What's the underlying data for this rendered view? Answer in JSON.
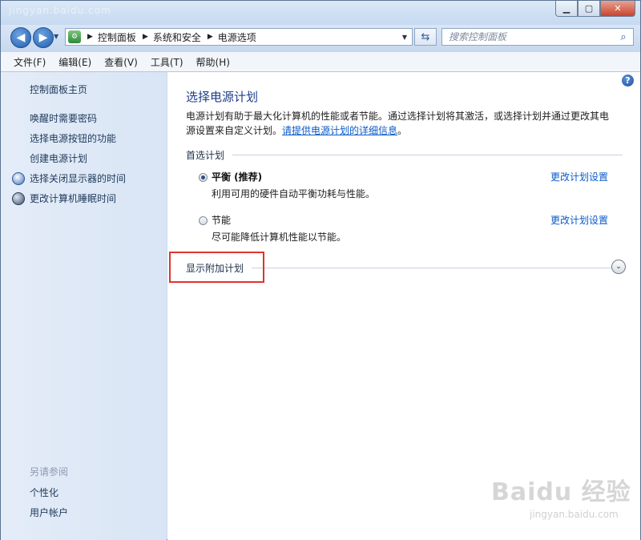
{
  "window": {
    "ghost_title": "jingyan.baidu.com"
  },
  "caption_buttons": {
    "minimize": "▁",
    "maximize": "▢",
    "close": "✕"
  },
  "nav": {
    "back_glyph": "◀",
    "forward_glyph": "▶",
    "breadcrumb": [
      "控制面板",
      "系统和安全",
      "电源选项"
    ],
    "breadcrumb_icon": "control-panel-icon",
    "search_placeholder": "搜索控制面板"
  },
  "menu": [
    "文件(F)",
    "编辑(E)",
    "查看(V)",
    "工具(T)",
    "帮助(H)"
  ],
  "sidebar": {
    "home": "控制面板主页",
    "items": [
      {
        "label": "唤醒时需要密码",
        "icon": null
      },
      {
        "label": "选择电源按钮的功能",
        "icon": null
      },
      {
        "label": "创建电源计划",
        "icon": null
      },
      {
        "label": "选择关闭显示器的时间",
        "icon": "monitor-clock-icon"
      },
      {
        "label": "更改计算机睡眠时间",
        "icon": "sleep-moon-icon"
      }
    ],
    "see_also_title": "另请参阅",
    "see_also": [
      "个性化",
      "用户帐户"
    ]
  },
  "main": {
    "title": "选择电源计划",
    "desc_line1": "电源计划有助于最大化计算机的性能或者节能。通过选择计划将其激活，或选择计划并通过更改其电",
    "desc_line2_prefix": "源设置来自定义计划。",
    "desc_link": "请提供电源计划的详细信息",
    "desc_line2_suffix": "。",
    "preferred_heading": "首选计划",
    "plans": [
      {
        "name": "平衡 (推荐)",
        "desc": "利用可用的硬件自动平衡功耗与性能。",
        "link": "更改计划设置",
        "selected": true
      },
      {
        "name": "节能",
        "desc": "尽可能降低计算机性能以节能。",
        "link": "更改计划设置",
        "selected": false
      }
    ],
    "additional_plans": "显示附加计划",
    "help_glyph": "?"
  },
  "watermark": {
    "logo": "Baidu 经验",
    "url": "jingyan.baidu.com"
  },
  "colors": {
    "highlight_box": "#e0332f",
    "link": "#0b5bc9",
    "title": "#1e3d8a"
  }
}
